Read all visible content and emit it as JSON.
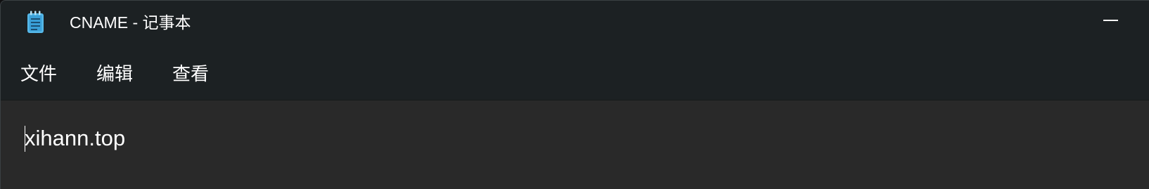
{
  "window": {
    "title": "CNAME - 记事本",
    "minimize_icon": "minimize-icon",
    "app_icon": "notepad-icon"
  },
  "menu": {
    "items": [
      {
        "label": "文件"
      },
      {
        "label": "编辑"
      },
      {
        "label": "查看"
      }
    ]
  },
  "editor": {
    "content": "xihann.top"
  },
  "colors": {
    "titlebar_bg": "#1c2123",
    "editor_bg": "#292929",
    "text": "#ffffff",
    "icon_blue": "#4fc3f7"
  }
}
